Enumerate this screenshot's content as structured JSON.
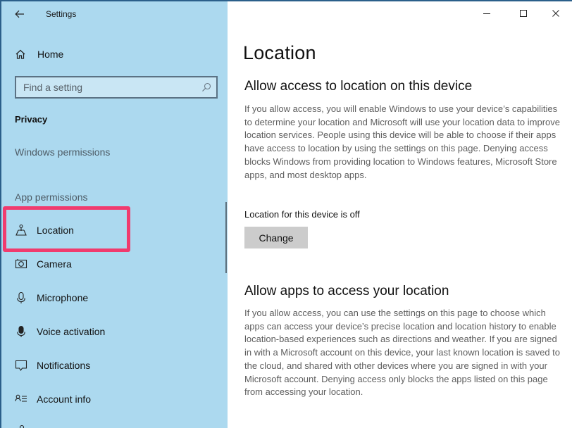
{
  "window": {
    "app_title": "Settings",
    "controls": {
      "minimize": "minimize",
      "maximize": "maximize",
      "close": "close"
    }
  },
  "sidebar": {
    "back_icon": "arrow-left-icon",
    "home": {
      "label": "Home",
      "icon": "home-icon"
    },
    "search": {
      "placeholder": "Find a setting",
      "value": "",
      "icon": "search-icon"
    },
    "section": "Privacy",
    "windows_permissions_label": "Windows permissions",
    "app_permissions_label": "App permissions",
    "items": [
      {
        "label": "Location",
        "icon": "location-icon",
        "selected": true,
        "highlighted": true
      },
      {
        "label": "Camera",
        "icon": "camera-icon"
      },
      {
        "label": "Microphone",
        "icon": "microphone-icon"
      },
      {
        "label": "Voice activation",
        "icon": "voice-activation-icon"
      },
      {
        "label": "Notifications",
        "icon": "notifications-icon"
      },
      {
        "label": "Account info",
        "icon": "account-info-icon"
      }
    ],
    "highlight_color": "#f03b6e",
    "background_color": "#acd9ef"
  },
  "main": {
    "title": "Location",
    "device_section": {
      "heading": "Allow access to location on this device",
      "description": "If you allow access, you will enable Windows to use your device’s capabilities to determine your location and Microsoft will use your location data to improve location services. People using this device will be able to choose if their apps have access to location by using the settings on this page. Denying access blocks Windows from providing location to Windows features, Microsoft Store apps, and most desktop apps.",
      "status": "Location for this device is off",
      "change_button": "Change"
    },
    "apps_section": {
      "heading": "Allow apps to access your location",
      "description": "If you allow access, you can use the settings on this page to choose which apps can access your device’s precise location and location history to enable location-based experiences such as directions and weather. If you are signed in with a Microsoft account on this device, your last known location is saved to the cloud, and shared with other devices where you are signed in with your Microsoft account. Denying access only blocks the apps listed on this page from accessing your location."
    }
  }
}
